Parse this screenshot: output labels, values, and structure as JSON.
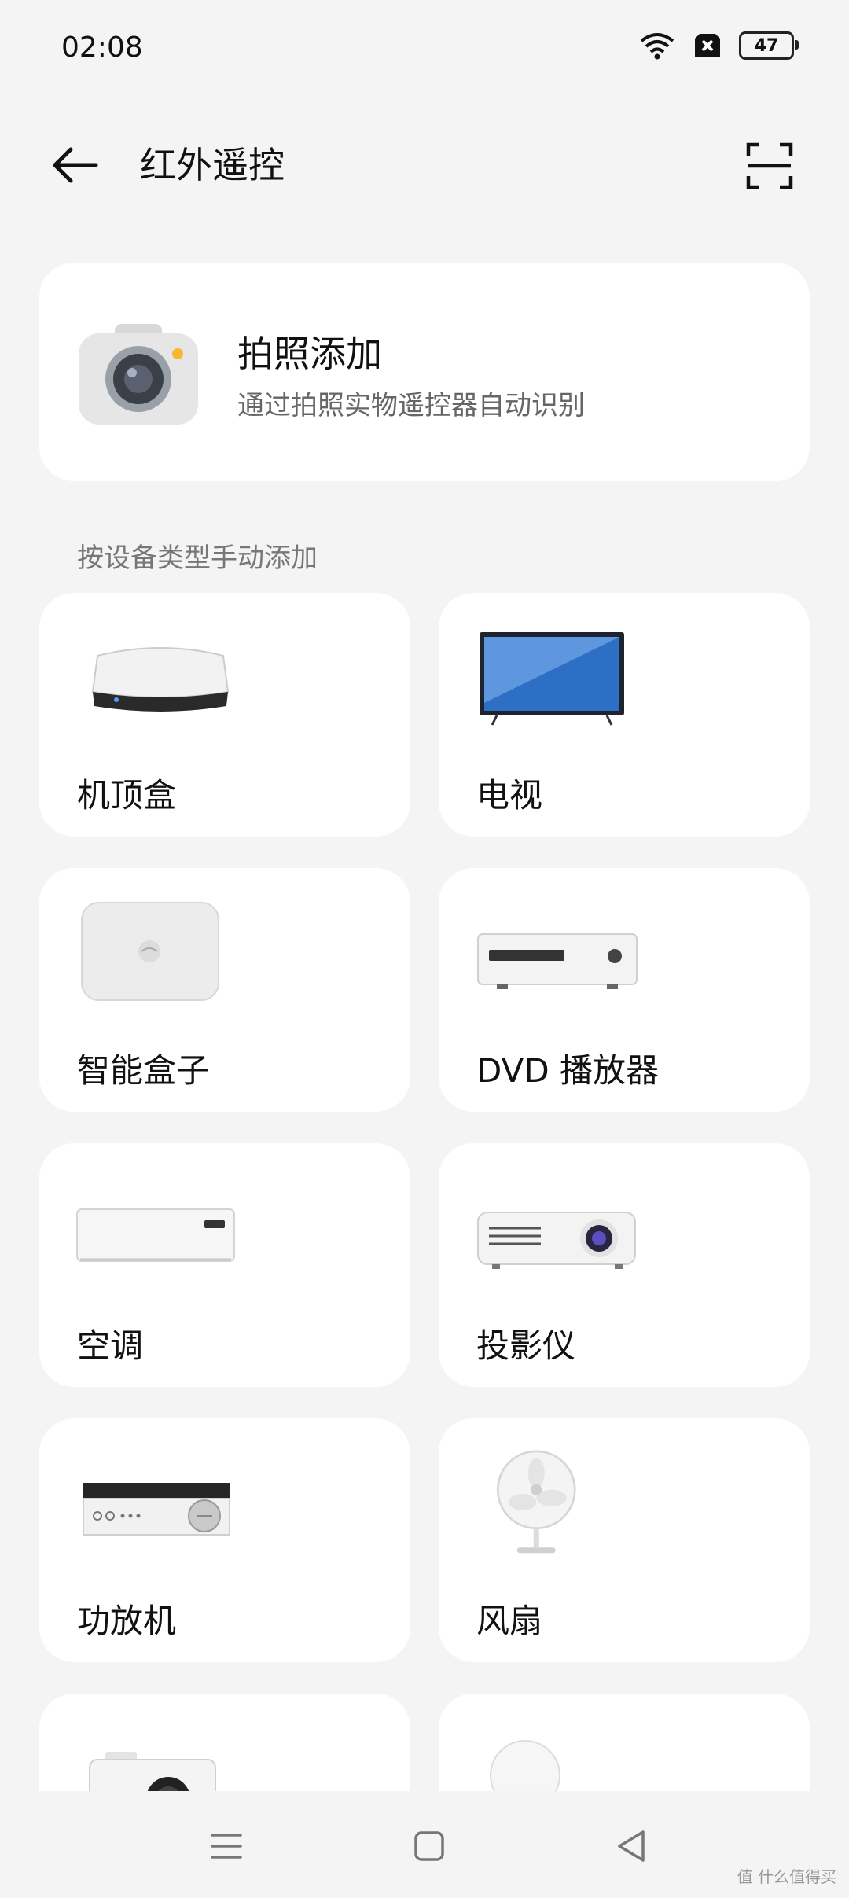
{
  "status_bar": {
    "time": "02:08",
    "battery_level": "47"
  },
  "header": {
    "title": "红外遥控"
  },
  "photo_add": {
    "title": "拍照添加",
    "subtitle": "通过拍照实物遥控器自动识别"
  },
  "section": {
    "label": "按设备类型手动添加"
  },
  "devices": [
    {
      "label": "机顶盒",
      "icon": "set-top-box-icon"
    },
    {
      "label": "电视",
      "icon": "tv-icon"
    },
    {
      "label": "智能盒子",
      "icon": "smart-box-icon"
    },
    {
      "label": "DVD 播放器",
      "icon": "dvd-player-icon"
    },
    {
      "label": "空调",
      "icon": "air-conditioner-icon"
    },
    {
      "label": "投影仪",
      "icon": "projector-icon"
    },
    {
      "label": "功放机",
      "icon": "amplifier-icon"
    },
    {
      "label": "风扇",
      "icon": "fan-icon"
    },
    {
      "label": "",
      "icon": "camera-device-icon"
    },
    {
      "label": "",
      "icon": "light-bulb-icon"
    }
  ],
  "watermark": "值 什么值得买"
}
